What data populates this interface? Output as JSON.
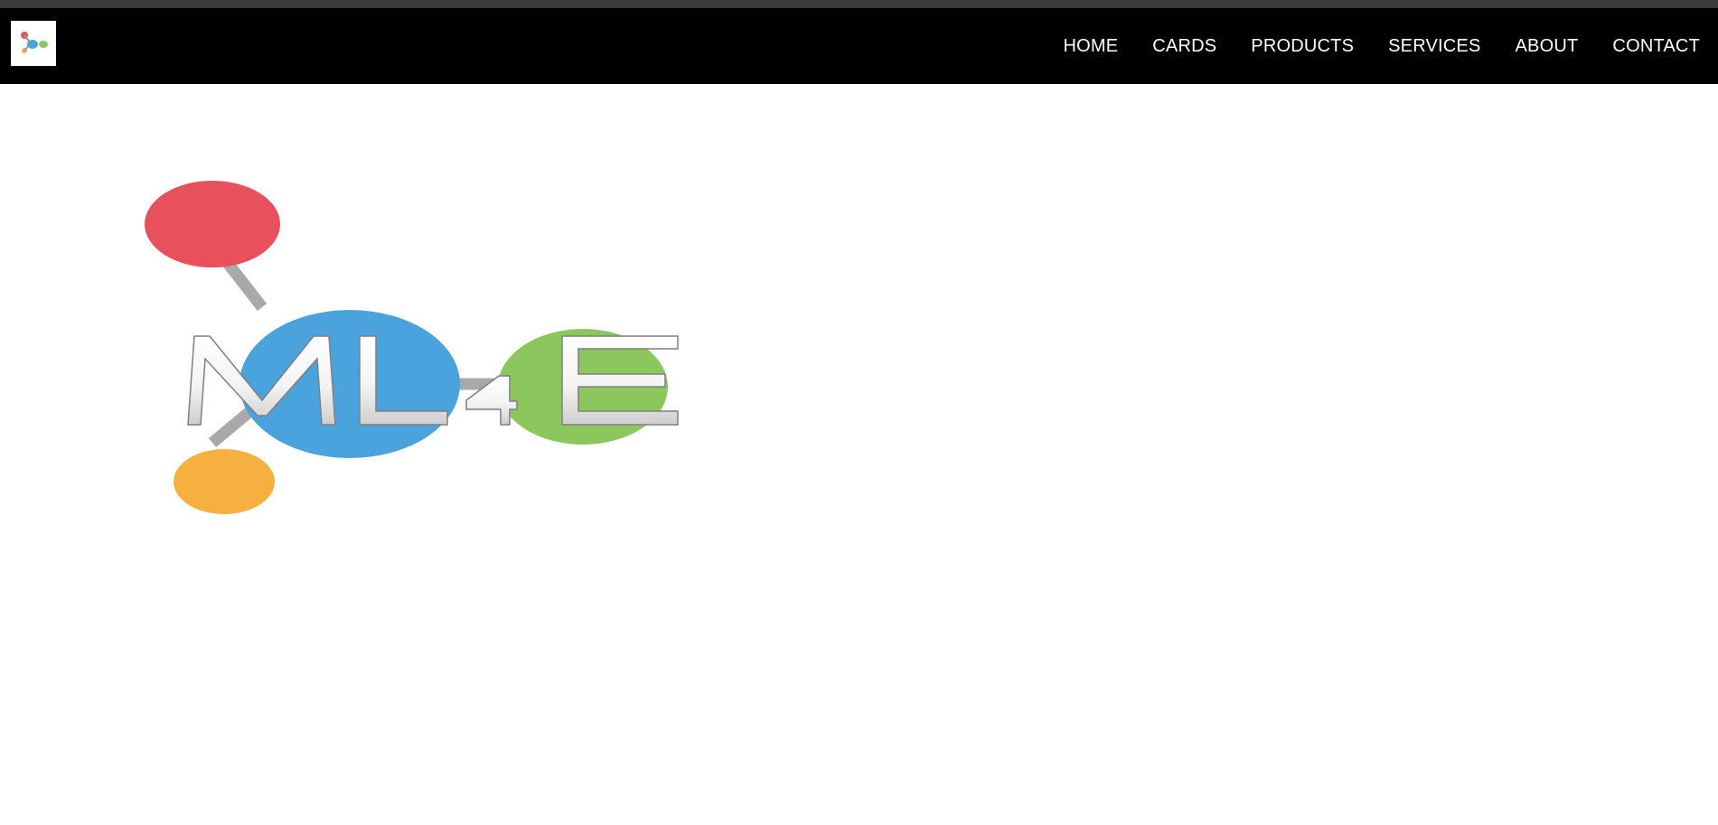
{
  "navbar": {
    "logo_icon": "ml4e-logo-icon",
    "items": [
      {
        "label": "HOME"
      },
      {
        "label": "CARDS"
      },
      {
        "label": "PRODUCTS"
      },
      {
        "label": "SERVICES"
      },
      {
        "label": "ABOUT"
      },
      {
        "label": "CONTACT"
      }
    ]
  },
  "hero": {
    "logo_text": "ML4E",
    "logo_colors": {
      "red_node": "#e8505b",
      "blue_node": "#4aa3dc",
      "green_node": "#8cc75d",
      "orange_node": "#f5b040"
    }
  },
  "theme": {
    "navbar_bg": "#000000",
    "nav_text": "#ffffff",
    "page_bg": "#ffffff"
  }
}
